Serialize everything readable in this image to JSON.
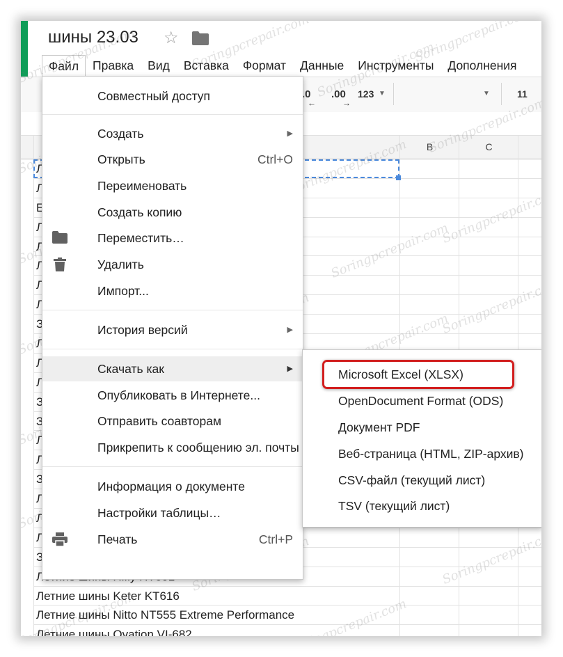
{
  "document": {
    "title": "шины 23.03"
  },
  "menubar": [
    "Файл",
    "Правка",
    "Вид",
    "Вставка",
    "Формат",
    "Данные",
    "Инструменты",
    "Дополнения"
  ],
  "toolbar": {
    "decrease_decimal": ".0",
    "increase_decimal": ".00",
    "more_formats": "123",
    "font_size": "11"
  },
  "columns": [
    "B",
    "C"
  ],
  "rows": [
    "Летние шины Hifly HT601",
    "Летние шины Keter KT616",
    "Летние шины Nitto NT555 Extreme Performance",
    "Летние шины Ovation VI-682"
  ],
  "partial_row_chars": [
    "Л",
    "Л",
    "Е",
    "Л",
    "Л",
    "Л",
    "Л",
    "Л",
    "З",
    "Л",
    "Л",
    "Л",
    "З",
    "З",
    "Л",
    "Л",
    "З",
    "Л",
    "Л",
    "Л",
    "З"
  ],
  "file_menu": {
    "share": "Совместный доступ",
    "new": "Создать",
    "open": "Открыть",
    "open_shortcut": "Ctrl+O",
    "rename": "Переименовать",
    "make_copy": "Создать копию",
    "move": "Переместить…",
    "delete": "Удалить",
    "import": "Импорт...",
    "version_history": "История версий",
    "download_as": "Скачать как",
    "publish": "Опубликовать в Интернете...",
    "email_collaborators": "Отправить соавторам",
    "email_attachment": "Прикрепить к сообщению эл. почты",
    "doc_details": "Информация о документе",
    "spreadsheet_settings": "Настройки таблицы…",
    "print": "Печать",
    "print_shortcut": "Ctrl+P"
  },
  "download_submenu": [
    "Microsoft Excel (XLSX)",
    "OpenDocument Format (ODS)",
    "Документ PDF",
    "Веб-страница (HTML, ZIP-архив)",
    "CSV-файл (текущий лист)",
    "TSV (текущий лист)"
  ],
  "watermark": "Soringpcrepair.com",
  "colors": {
    "accent_green": "#0f9d58",
    "highlight_red": "#d21f1f",
    "selection_blue": "#4a89dc"
  }
}
